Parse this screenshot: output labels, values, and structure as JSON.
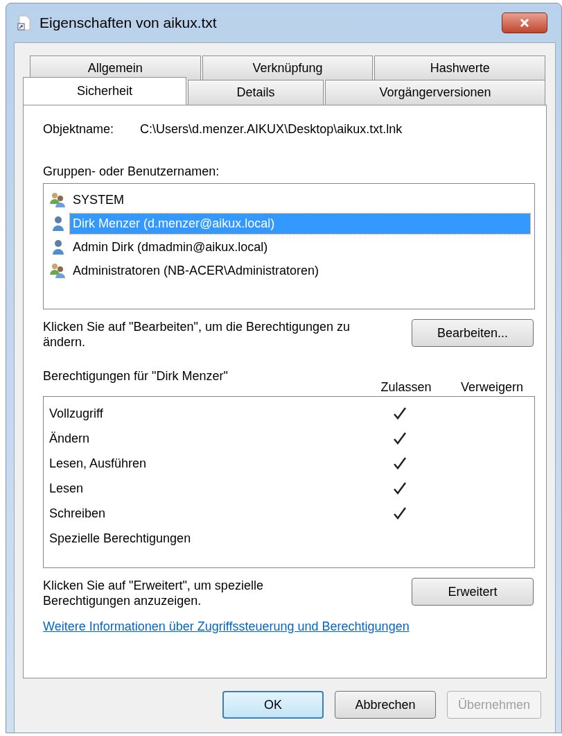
{
  "window": {
    "title": "Eigenschaften von aikux.txt"
  },
  "tab_rows": [
    [
      {
        "label": "Allgemein",
        "selected": false
      },
      {
        "label": "Verknüpfung",
        "selected": false
      },
      {
        "label": "Hashwerte",
        "selected": false
      }
    ],
    [
      {
        "label": "Sicherheit",
        "selected": true
      },
      {
        "label": "Details",
        "selected": false
      },
      {
        "label": "Vorgängerversionen",
        "selected": false
      }
    ]
  ],
  "object": {
    "label": "Objektname:",
    "value": "C:\\Users\\d.menzer.AIKUX\\Desktop\\aikux.txt.lnk"
  },
  "groups": {
    "label": "Gruppen- oder Benutzernamen:",
    "items": [
      {
        "name": "SYSTEM",
        "kind": "group",
        "selected": false
      },
      {
        "name": "Dirk Menzer (d.menzer@aikux.local)",
        "kind": "user",
        "selected": true
      },
      {
        "name": "Admin Dirk (dmadmin@aikux.local)",
        "kind": "user",
        "selected": false
      },
      {
        "name": "Administratoren (NB-ACER\\Administratoren)",
        "kind": "group",
        "selected": false
      }
    ]
  },
  "edit_hint": "Klicken Sie auf \"Bearbeiten\", um die Berechtigungen zu ändern.",
  "edit_button": "Bearbeiten...",
  "permissions": {
    "label": "Berechtigungen für \"Dirk Menzer\"",
    "allow_header": "Zulassen",
    "deny_header": "Verweigern",
    "rows": [
      {
        "name": "Vollzugriff",
        "allow": true,
        "deny": false
      },
      {
        "name": "Ändern",
        "allow": true,
        "deny": false
      },
      {
        "name": "Lesen, Ausführen",
        "allow": true,
        "deny": false
      },
      {
        "name": "Lesen",
        "allow": true,
        "deny": false
      },
      {
        "name": "Schreiben",
        "allow": true,
        "deny": false
      },
      {
        "name": "Spezielle Berechtigungen",
        "allow": false,
        "deny": false
      }
    ]
  },
  "advanced_hint": "Klicken Sie auf \"Erweitert\", um spezielle Berechtigungen anzuzeigen.",
  "advanced_button": "Erweitert",
  "link": "Weitere Informationen über Zugriffssteuerung und Berechtigungen",
  "buttons": [
    {
      "label": "OK",
      "kind": "default",
      "disabled": false
    },
    {
      "label": "Abbrechen",
      "kind": "normal",
      "disabled": false
    },
    {
      "label": "Übernehmen",
      "kind": "normal",
      "disabled": true
    }
  ]
}
